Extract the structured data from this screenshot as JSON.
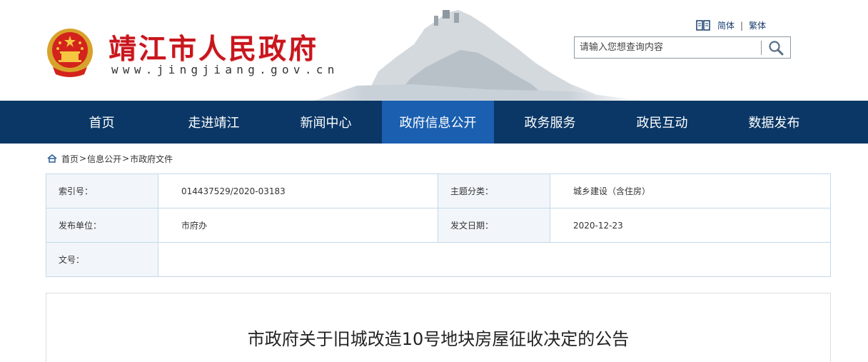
{
  "header": {
    "site_title": "靖江市人民政府",
    "site_url": "www.jingjiang.gov.cn",
    "lang_simplified": "简体",
    "lang_separator": "|",
    "lang_traditional": "繁体",
    "search_placeholder": "请输入您想查询内容"
  },
  "nav": {
    "items": [
      "首页",
      "走进靖江",
      "新闻中心",
      "政府信息公开",
      "政务服务",
      "政民互动",
      "数据发布"
    ],
    "active_index": 3
  },
  "breadcrumb": {
    "items": [
      "首页",
      "信息公开",
      "市政府文件"
    ],
    "separator": ">"
  },
  "meta": {
    "index_label": "索引号：",
    "index_value": "014437529/2020-03183",
    "topic_label": "主题分类：",
    "topic_value": "城乡建设（含住房）",
    "publisher_label": "发布单位：",
    "publisher_value": "市府办",
    "date_label": "发文日期：",
    "date_value": "2020-12-23",
    "docno_label": "文号：",
    "docno_value": ""
  },
  "document": {
    "title": "市政府关于旧城改造10号地块房屋征收决定的公告"
  },
  "colors": {
    "title_red": "#c8161d",
    "nav_bg": "#0a3766",
    "nav_active": "#1a5fb0",
    "table_border": "#c4d8ea",
    "label_bg": "#f2f6fa"
  }
}
